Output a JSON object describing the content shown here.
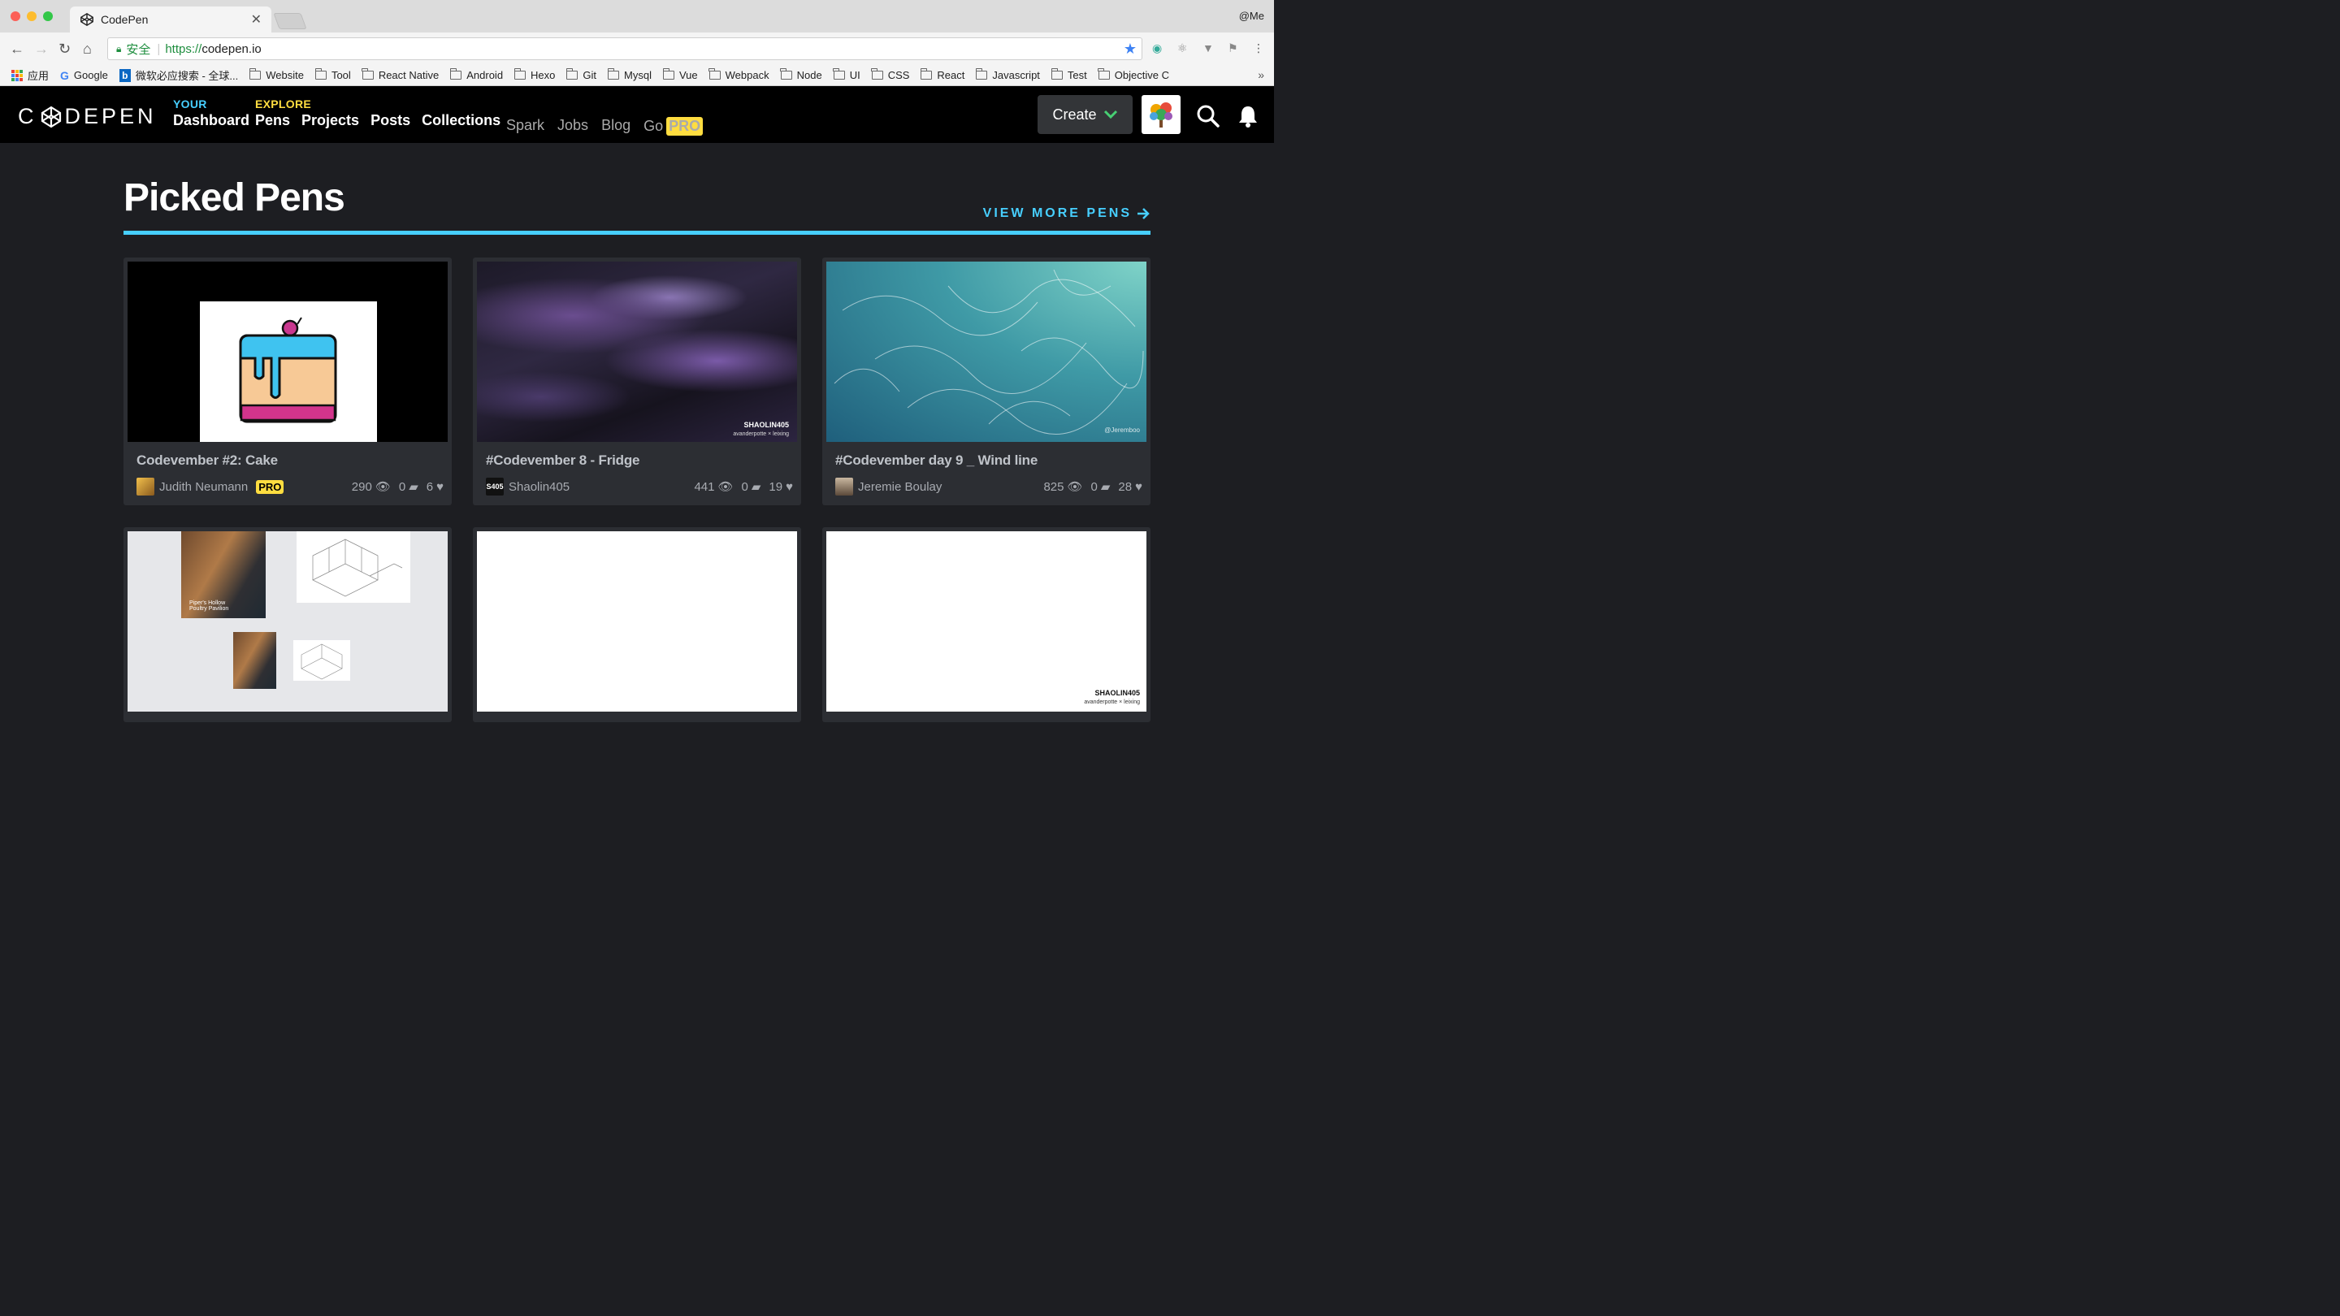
{
  "browser": {
    "tab_title": "CodePen",
    "profile": "@Me",
    "secure_label": "安全",
    "url_scheme": "https://",
    "url_host": "codepen.io",
    "bookmarks": {
      "apps": "应用",
      "google": "Google",
      "bing": "微软必应搜索 - 全球...",
      "folders": [
        "Website",
        "Tool",
        "React Native",
        "Android",
        "Hexo",
        "Git",
        "Mysql",
        "Vue",
        "Webpack",
        "Node",
        "UI",
        "CSS",
        "React",
        "Javascript",
        "Test",
        "Objective C"
      ]
    }
  },
  "header": {
    "your_label": "YOUR",
    "dashboard": "Dashboard",
    "explore_label": "EXPLORE",
    "explore_links": [
      "Pens",
      "Projects",
      "Posts",
      "Collections"
    ],
    "secondary_links": [
      "Spark",
      "Jobs",
      "Blog"
    ],
    "go_label": "Go",
    "pro_label": "PRO",
    "create_label": "Create",
    "colors": {
      "your": "#47cfff",
      "explore": "#ffdd40"
    }
  },
  "main": {
    "section_title": "Picked Pens",
    "view_more": "VIEW MORE PENS",
    "cards": [
      {
        "title": "Codevember #2: Cake",
        "author": "Judith Neumann",
        "pro": "PRO",
        "views": "290",
        "comments": "0",
        "likes": "6"
      },
      {
        "title": "#Codevember 8 - Fridge",
        "author": "Shaolin405",
        "views": "441",
        "comments": "0",
        "likes": "19",
        "preview_caption": "SHAOLIN405",
        "preview_subcaption": "avanderpotte × leixing"
      },
      {
        "title": "#Codevember day 9 _ Wind line",
        "author": "Jeremie Boulay",
        "views": "825",
        "comments": "0",
        "likes": "28",
        "preview_caption": "@Jeremboo"
      },
      {
        "preview_caption": "Piper's Hollow Poultry Pavilion"
      },
      {},
      {
        "preview_caption": "SHAOLIN405",
        "preview_subcaption": "avanderpotte × leixing"
      }
    ]
  }
}
